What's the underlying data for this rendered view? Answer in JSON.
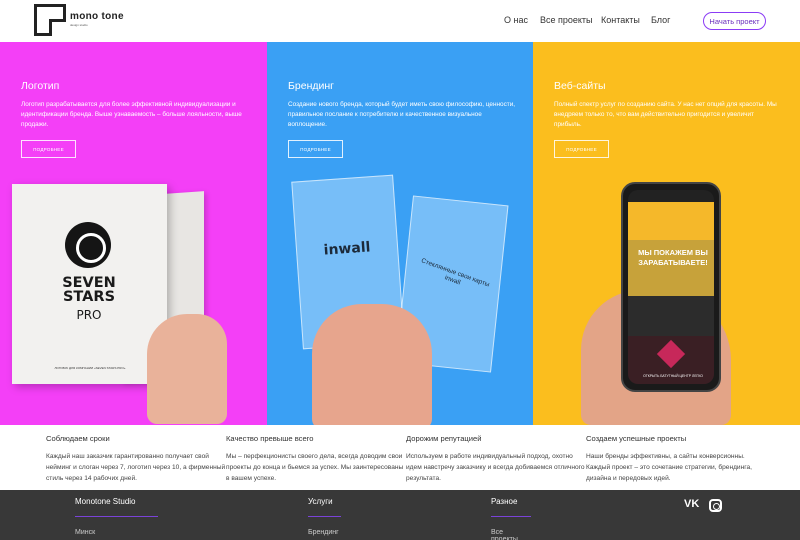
{
  "header": {
    "logo_word": "mono tone",
    "logo_sub": "design studio",
    "nav": [
      "О нас",
      "Все проекты",
      "Контакты",
      "Блог"
    ],
    "cta": "Начать проект"
  },
  "panels": [
    {
      "title": "Логотип",
      "desc": "Логотип разрабатывается для более эффективной индивидуализации и идентификации бренда. Выше узнаваемость – больше лояльности, выше продажи.",
      "button": "ПОДРОБНЕЕ",
      "color": "#f43ff7",
      "book": {
        "brand_line1": "SEVEN",
        "brand_line2": "STARS",
        "brand_line3": "PRO",
        "caption": "ЛОГОБУК ДЛЯ КОМПАНИИ «SEVEN STARS PRO»"
      }
    },
    {
      "title": "Брендинг",
      "desc": "Создание нового бренда, который будет иметь свою философию, ценности, правильное послание к потребителю и качественное визуальное воплощение.",
      "button": "ПОДРОБНЕЕ",
      "color": "#3aa0f4",
      "cards": {
        "brand": "inwall",
        "glass_text": "Стеклянные свои карты inwall"
      }
    },
    {
      "title": "Веб-сайты",
      "desc": "Полный спектр услуг по созданию сайта. У нас нет опций для красоты. Мы внедряем только то, что вам действительно пригодится и увеличит прибыль.",
      "button": "ПОДРОБНЕЕ",
      "color": "#fbbe1e",
      "phone": {
        "headline": "МЫ ПОКАЖЕМ ВЫ ЗАРАБАТЫВАЕТЕ!",
        "cta": "ОТКРЫТЬ БАТУТНЫЙ ЦЕНТР ЛЕГКО"
      }
    }
  ],
  "features": [
    {
      "title": "Соблюдаем сроки",
      "text": "Каждый наш заказчик гарантированно получает свой нейминг и слоган через 7, логотип через 10, а фирменный стиль через 14 рабочих дней."
    },
    {
      "title": "Качество превыше всего",
      "text": "Мы – перфекционисты своего дела, всегда доводим свои проекты до конца и бьемся за успех. Мы заинтересованы в вашем успехе."
    },
    {
      "title": "Дорожим репутацией",
      "text": "Используем в работе индивидуальный подход, охотно идем навстречу заказчику и всегда добиваемся отличного результата."
    },
    {
      "title": "Создаем успешные проекты",
      "text": "Наши бренды эффективны, а сайты конверсионны. Каждый проект – это сочетание стратегии, брендинга, дизайна и передовых идей."
    }
  ],
  "footer": {
    "columns": [
      {
        "title": "Monotone Studio",
        "link": "Минск"
      },
      {
        "title": "Услуги",
        "link": "Брендинг"
      },
      {
        "title": "Разное",
        "link": "Все проекты"
      }
    ],
    "social": {
      "vk": "VK",
      "instagram": "instagram-icon"
    },
    "accent": "#7a43d9"
  }
}
